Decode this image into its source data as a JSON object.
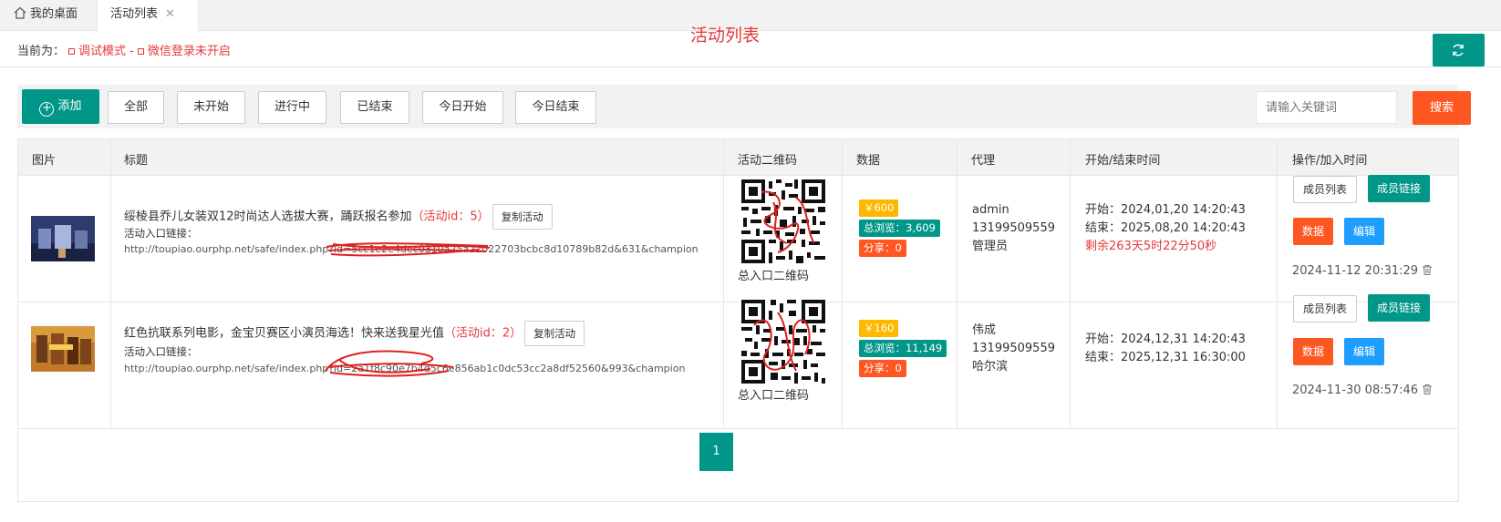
{
  "tabs": [
    {
      "label": "我的桌面",
      "icon": "home-icon"
    },
    {
      "label": "活动列表",
      "active": true,
      "close": "✕"
    }
  ],
  "page_title": "活动列表",
  "mode": {
    "prefix": "当前为：",
    "debug": "调试模式 -",
    "wechat": "微信登录未开启"
  },
  "toolbar": {
    "add_label": "添加",
    "filters": [
      "全部",
      "未开始",
      "进行中",
      "已结束",
      "今日开始",
      "今日结束"
    ],
    "search_placeholder": "请输入关键词",
    "search_label": "搜索"
  },
  "table": {
    "headers": [
      "图片",
      "标题",
      "活动二维码",
      "数据",
      "代理",
      "开始/结束时间",
      "操作/加入时间"
    ],
    "rows": [
      {
        "title": "绥棱县乔儿女装双12时尚达人选拔大赛，踊跃报名参加",
        "activity_id": "（活动id：5）",
        "copy_label": "复制活动",
        "link_label": "活动入口链接：",
        "link_url": "http://toupiao.ourphp.net/safe/index.php?id=5cc1e2e4dec0310a25a22022703bcbc8d10789b82d&631&champion",
        "qr_label": "总入口二维码",
        "price": "￥600",
        "views": "总浏览：3,609",
        "shares": "分享：0",
        "agent_name": "admin",
        "agent_phone": "13199509559",
        "agent_role": "管理员",
        "start": "开始：2024,01,20 14:20:43",
        "end": "结束：2025,08,20 14:20:43",
        "remain": "剩余263天5时22分50秒",
        "btn_members": "成员列表",
        "btn_member_link": "成员链接",
        "btn_data": "数据",
        "btn_edit": "编辑",
        "added": "2024-11-12 20:31:29"
      },
      {
        "title": "红色抗联系列电影，金宝贝赛区小演员海选！快来送我星光值",
        "activity_id": "（活动id：2）",
        "copy_label": "复制活动",
        "link_label": "活动入口链接：",
        "link_url": "http://toupiao.ourphp.net/safe/index.php?id=2a1f8c90e7b4d5c6e856ab1c0dc53cc2a8df52560&993&champion",
        "qr_label": "总入口二维码",
        "price": "￥160",
        "views": "总浏览：11,149",
        "shares": "分享：0",
        "agent_name": "伟成",
        "agent_phone": "13199509559",
        "agent_role": "哈尔滨",
        "start": "开始：2024,12,31 14:20:43",
        "end": "结束：2025,12,31 16:30:00",
        "remain": "",
        "btn_members": "成员列表",
        "btn_member_link": "成员链接",
        "btn_data": "数据",
        "btn_edit": "编辑",
        "added": "2024-11-30 08:57:46"
      }
    ]
  },
  "pagination": {
    "current": "1"
  },
  "colors": {
    "primary": "#009688",
    "danger": "#ff5722",
    "info": "#1e9fff",
    "warn": "#ffb800",
    "red_text": "#e4393c"
  }
}
